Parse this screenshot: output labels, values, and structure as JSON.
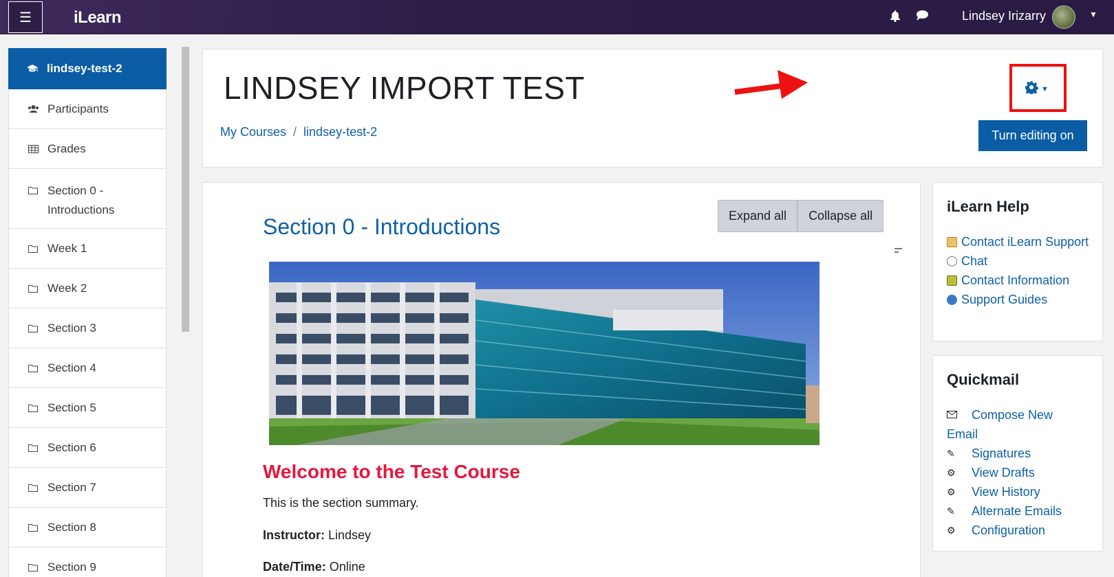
{
  "navbar": {
    "brand": "iLearn",
    "user_name": "Lindsey Irizarry",
    "menu_icon": "hamburger-icon",
    "notification_icon": "bell-icon",
    "message_icon": "chat-icon"
  },
  "drawer": {
    "items": [
      {
        "label": "lindsey-test-2",
        "icon": "graduation-cap-icon"
      },
      {
        "label": "Participants",
        "icon": "users-icon"
      },
      {
        "label": "Grades",
        "icon": "table-icon"
      },
      {
        "label": "Section 0 - Introductions",
        "icon": "folder-icon"
      },
      {
        "label": "Week 1",
        "icon": "folder-icon"
      },
      {
        "label": "Week 2",
        "icon": "folder-icon"
      },
      {
        "label": "Section 3",
        "icon": "folder-icon"
      },
      {
        "label": "Section 4",
        "icon": "folder-icon"
      },
      {
        "label": "Section 5",
        "icon": "folder-icon"
      },
      {
        "label": "Section 6",
        "icon": "folder-icon"
      },
      {
        "label": "Section 7",
        "icon": "folder-icon"
      },
      {
        "label": "Section 8",
        "icon": "folder-icon"
      },
      {
        "label": "Section 9",
        "icon": "folder-icon"
      }
    ]
  },
  "header": {
    "title": "LINDSEY IMPORT TEST",
    "breadcrumb": [
      "My Courses",
      "lindsey-test-2"
    ],
    "breadcrumb_separator": "/",
    "edit_button": "Turn editing on",
    "highlight_color": "#ee1111"
  },
  "main": {
    "expand_all": "Expand all",
    "collapse_all": "Collapse all",
    "section_title": "Section 0 - Introductions",
    "welcome_heading": "Welcome to the Test Course",
    "summary": "This is the section summary.",
    "instructor_label": "Instructor:",
    "instructor_value": " Lindsey",
    "datetime_label": "Date/Time:",
    "datetime_value": " Online"
  },
  "help_block": {
    "title": "iLearn Help",
    "links": [
      "Contact iLearn Support",
      "Chat",
      "Contact Information",
      "Support Guides"
    ]
  },
  "quickmail_block": {
    "title": "Quickmail",
    "links": [
      {
        "label": "Compose New",
        "cont": "Email",
        "icon": "envelope-icon"
      },
      {
        "label": "Signatures",
        "icon": "pencil-icon"
      },
      {
        "label": "View Drafts",
        "icon": "gear-icon"
      },
      {
        "label": "View History",
        "icon": "gear-icon"
      },
      {
        "label": "Alternate Emails",
        "icon": "pencil-icon"
      },
      {
        "label": "Configuration",
        "icon": "gear-icon"
      }
    ]
  },
  "colors": {
    "primary": "#0a5da5",
    "link": "#0f60a8",
    "welcome": "#e5173f"
  }
}
